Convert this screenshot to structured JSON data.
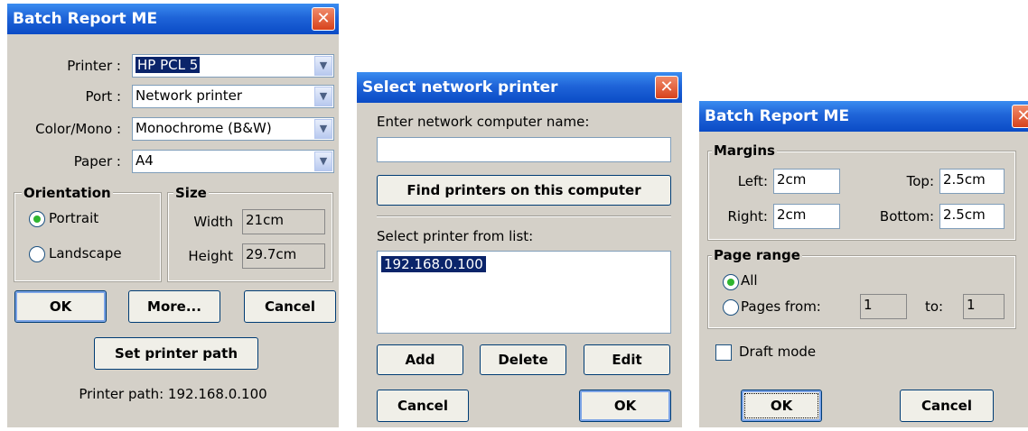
{
  "dialog1": {
    "title": "Batch Report ME",
    "close": "✕",
    "printer_label": "Printer :",
    "printer_value": "HP PCL 5",
    "port_label": "Port :",
    "port_value": "Network printer",
    "color_label": "Color/Mono :",
    "color_value": "Monochrome (B&W)",
    "paper_label": "Paper :",
    "paper_value": "A4",
    "orientation_title": "Orientation",
    "portrait": "Portrait",
    "landscape": "Landscape",
    "size_title": "Size",
    "width_label": "Width",
    "width_value": "21cm",
    "height_label": "Height",
    "height_value": "29.7cm",
    "ok": "OK",
    "more": "More...",
    "cancel": "Cancel",
    "set_path": "Set printer path",
    "printer_path": "Printer path: 192.168.0.100"
  },
  "dialog2": {
    "title": "Select network printer",
    "close": "✕",
    "enter_label": "Enter network computer name:",
    "computer_name_value": "",
    "find": "Find printers on this computer",
    "select_label": "Select printer from list:",
    "printers": [
      "192.168.0.100"
    ],
    "add": "Add",
    "delete": "Delete",
    "edit": "Edit",
    "cancel": "Cancel",
    "ok": "OK"
  },
  "dialog3": {
    "title": "Batch Report ME",
    "close": "✕",
    "margins_title": "Margins",
    "left_label": "Left:",
    "left_value": "2cm",
    "top_label": "Top:",
    "top_value": "2.5cm",
    "right_label": "Right:",
    "right_value": "2cm",
    "bottom_label": "Bottom:",
    "bottom_value": "2.5cm",
    "page_range_title": "Page range",
    "all": "All",
    "pages_from": "Pages from:",
    "from_value": "1",
    "to_label": "to:",
    "to_value": "1",
    "draft_mode": "Draft mode",
    "ok": "OK",
    "cancel": "Cancel"
  },
  "icons": {
    "dropdown": "▼"
  }
}
